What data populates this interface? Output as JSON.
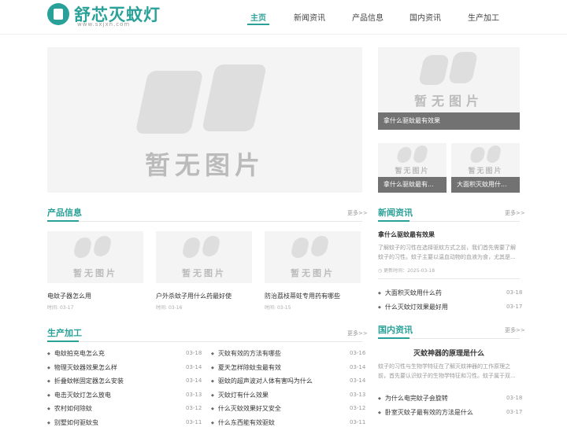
{
  "brand": {
    "name": "舒芯灭蚊灯",
    "domain": "www.sxjxn.com"
  },
  "nav": [
    {
      "label": "主页",
      "active": true
    },
    {
      "label": "新闻资讯",
      "active": false
    },
    {
      "label": "产品信息",
      "active": false
    },
    {
      "label": "国内资讯",
      "active": false
    },
    {
      "label": "生产加工",
      "active": false
    }
  ],
  "placeholder_text": "暂无图片",
  "hero": {
    "side_captions": [
      "拿什么驱蚊最有效果",
      "拿什么驱蚊最有...",
      "大面积灭蚊用什..."
    ]
  },
  "products": {
    "title": "产品信息",
    "more": "更多>>",
    "time_label": "时间:",
    "items": [
      {
        "title": "电蚊子器怎么用",
        "date": "03-17"
      },
      {
        "title": "户外杀蚊子用什么药最好使",
        "date": "03-16"
      },
      {
        "title": "防治荔枝蒂蛀专用药有哪些",
        "date": "03-15"
      }
    ]
  },
  "news": {
    "title": "新闻资讯",
    "more": "更多>>",
    "featured": {
      "title": "拿什么驱蚊最有效果",
      "summary": "了解蚊子的习性在选择驱蚊方式之前，我们首先需要了解蚊子的习性。蚊子主要以温血动物的血液为食，尤其是...",
      "time_label": "更新时间：",
      "date": "2025-03-18"
    },
    "list": [
      {
        "title": "大面积灭蚊用什么药",
        "date": "03-18"
      },
      {
        "title": "什么灭蚊灯效果最好用",
        "date": "03-17"
      }
    ]
  },
  "production": {
    "title": "生产加工",
    "more": "更多>>",
    "left": [
      {
        "title": "电蚊拍充电怎么充",
        "date": "03-18"
      },
      {
        "title": "物理灭蚊器效果怎么样",
        "date": "03-14"
      },
      {
        "title": "折叠蚊帐固定器怎么安装",
        "date": "03-14"
      },
      {
        "title": "电击灭蚊灯怎么放电",
        "date": "03-13"
      },
      {
        "title": "农村如何除蚊",
        "date": "03-12"
      },
      {
        "title": "别墅如何驱蚊虫",
        "date": "03-11"
      }
    ],
    "right": [
      {
        "title": "灭蚊有效的方法有哪些",
        "date": "03-16"
      },
      {
        "title": "夏天怎样除蚊虫最有效",
        "date": "03-14"
      },
      {
        "title": "驱蚊的超声波对人体有害吗为什么",
        "date": "03-14"
      },
      {
        "title": "灭蚊灯有什么效果",
        "date": "03-13"
      },
      {
        "title": "什么灭蚊效果好又安全",
        "date": "03-12"
      },
      {
        "title": "什么东西能有效驱蚊",
        "date": "03-11"
      }
    ]
  },
  "domestic": {
    "title": "国内资讯",
    "more": "更多>>",
    "featured": {
      "title": "灭蚊神器的原理是什么",
      "summary": "蚊子的习性与生物学特征在了解灭蚊神器的工作原理之前，首先要认识蚊子的生物学特征和习性。蚊子属于双..."
    },
    "list": [
      {
        "title": "为什么电完蚊子会旋转",
        "date": "03-18"
      },
      {
        "title": "卧室灭蚊子最有效的方法是什么",
        "date": "03-17"
      }
    ]
  }
}
